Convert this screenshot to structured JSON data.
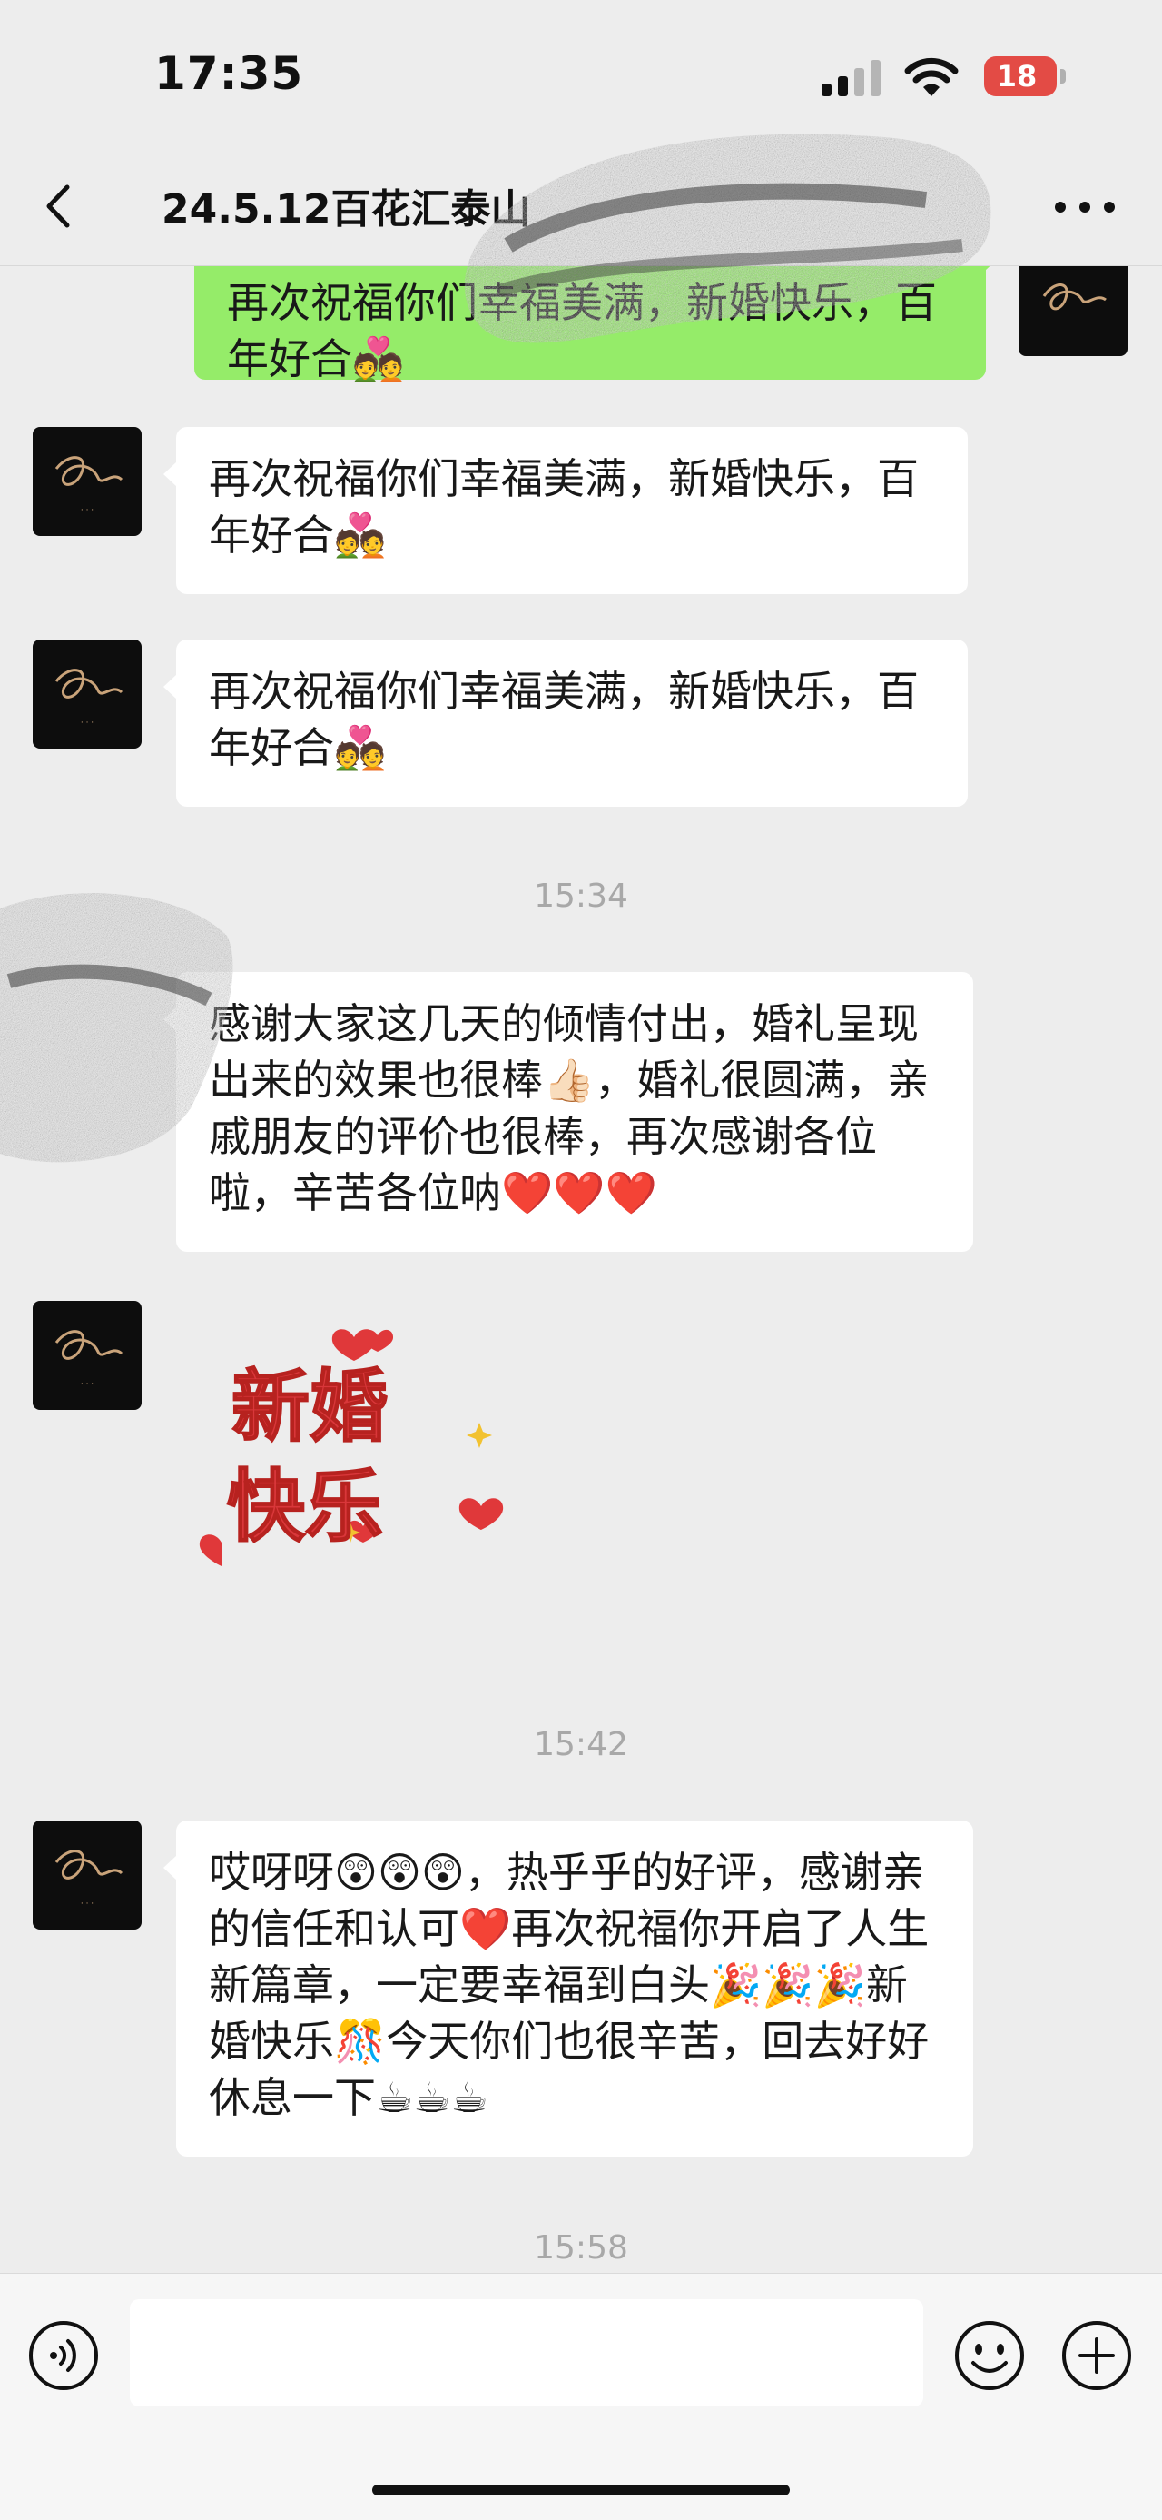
{
  "status_bar": {
    "time": "17:35",
    "battery": "18",
    "icons": [
      "cellular-signal-icon",
      "wifi-icon",
      "battery-icon"
    ]
  },
  "nav": {
    "title": "24.5.12百花汇泰山",
    "back_icon": "chevron-left-icon",
    "more_icon": "ellipsis-icon"
  },
  "messages": [
    {
      "type": "text",
      "direction": "outgoing",
      "partially_visible": true,
      "text": "再次祝福你们幸福美满，新婚快乐，百年好合💑"
    },
    {
      "type": "text",
      "direction": "incoming",
      "text": "再次祝福你们幸福美满，新婚快乐，百年好合💑"
    },
    {
      "type": "text",
      "direction": "incoming",
      "text": "再次祝福你们幸福美满，新婚快乐，百年好合💑"
    },
    {
      "type": "timestamp",
      "text": "15:34"
    },
    {
      "type": "text",
      "direction": "incoming",
      "sender_obscured": true,
      "text": "感谢大家这几天的倾情付出，婚礼呈现出来的效果也很棒👍🏻，婚礼很圆满，亲戚朋友的评价也很棒，再次感谢各位啦，辛苦各位呐❤️❤️❤️"
    },
    {
      "type": "sticker",
      "direction": "incoming",
      "sticker_text_line1": "新婚",
      "sticker_text_line2": "快乐"
    },
    {
      "type": "timestamp",
      "text": "15:42"
    },
    {
      "type": "text",
      "direction": "incoming",
      "text": "哎呀呀😲😲😲，热乎乎的好评，感谢亲的信任和认可❤️再次祝福你开启了人生新篇章，一定要幸福到白头🎉🎉🎉新婚快乐🎊今天你们也很辛苦，回去好好休息一下☕☕☕"
    },
    {
      "type": "timestamp",
      "text": "15:58"
    }
  ],
  "input_bar": {
    "input_value": "",
    "icons": [
      "voice-icon",
      "emoji-icon",
      "plus-icon"
    ]
  },
  "colors": {
    "background": "#ededed",
    "outgoing_bubble": "#95ec69",
    "incoming_bubble": "#ffffff",
    "timestamp": "#a8a8a8",
    "battery_low": "#e34b45"
  }
}
